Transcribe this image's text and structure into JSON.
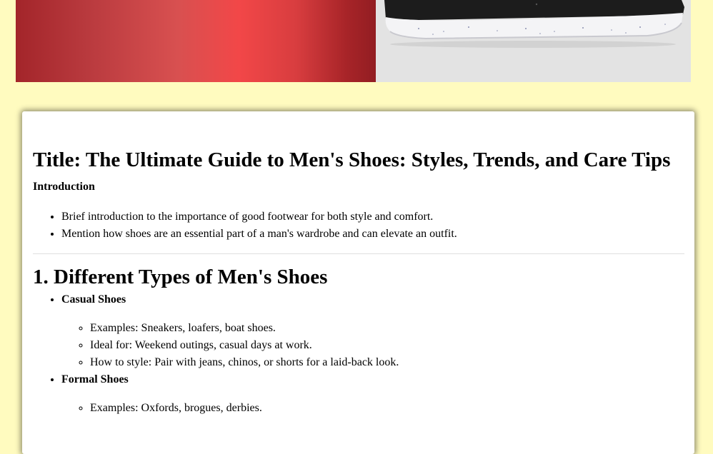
{
  "hero": {
    "left_colors": [
      "#a3252a",
      "#f24748",
      "#921d22"
    ],
    "right_background": "#e3e3e3",
    "product": "black sneaker with white speckled sole"
  },
  "article": {
    "title": "Title: The Ultimate Guide to Men's Shoes: Styles, Trends, and Care Tips",
    "intro_label": "Introduction",
    "intro_points": [
      "Brief introduction to the importance of good footwear for both style and comfort.",
      "Mention how shoes are an essential part of a man's wardrobe and can elevate an outfit."
    ],
    "section1": {
      "heading": "1. Different Types of Men's Shoes",
      "types": [
        {
          "label": "Casual Shoes",
          "points": [
            "Examples: Sneakers, loafers, boat shoes.",
            "Ideal for: Weekend outings, casual days at work.",
            "How to style: Pair with jeans, chinos, or shorts for a laid-back look."
          ]
        },
        {
          "label": "Formal Shoes",
          "points": [
            "Examples: Oxfords, brogues, derbies."
          ]
        }
      ]
    }
  },
  "colors": {
    "page_background": "#fffbbf",
    "card_background": "#ffffff"
  }
}
